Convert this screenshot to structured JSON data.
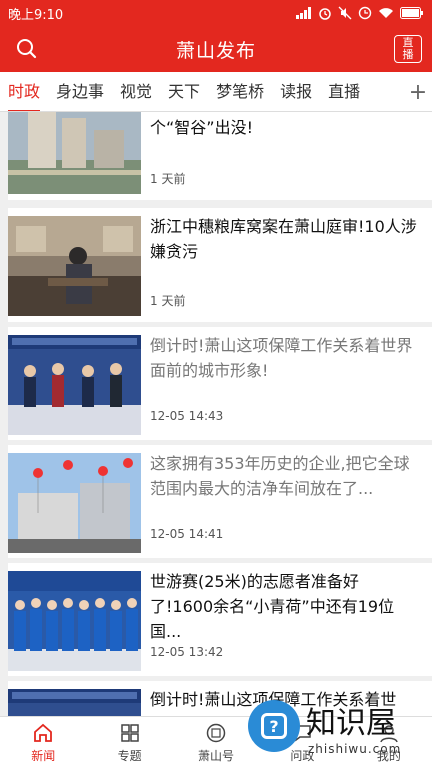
{
  "status": {
    "time": "晚上9:10"
  },
  "header": {
    "title": "萧山发布",
    "live_label": "直播"
  },
  "tabs": [
    "时政",
    "身边事",
    "视觉",
    "天下",
    "梦笔桥",
    "读报",
    "直播"
  ],
  "tab_add": "+",
  "articles": [
    {
      "title": "大动作!数字经济独角兽将在萧山这个“智谷”出没!",
      "time": "1 天前",
      "read": false
    },
    {
      "title": "浙江中穗粮库窝案在萧山庭审!10人涉嫌贪污",
      "time": "1 天前",
      "read": false
    },
    {
      "title": "倒计时!萧山这项保障工作关系着世界面前的城市形象!",
      "time": "12-05 14:43",
      "read": true
    },
    {
      "title": "这家拥有353年历史的企业,把它全球范围内最大的洁净车间放在了...",
      "time": "12-05 14:41",
      "read": true
    },
    {
      "title": "世游赛(25米)的志愿者准备好了!1600余名“小青荷”中还有19位国...",
      "time": "12-05 13:42",
      "read": false
    },
    {
      "title": "倒计时!萧山这项保障工作关系着世",
      "time": "",
      "read": false
    }
  ],
  "bottom_nav": [
    {
      "label": "新闻",
      "icon": "home-icon",
      "active": true
    },
    {
      "label": "专题",
      "icon": "grid-icon",
      "active": false
    },
    {
      "label": "萧山号",
      "icon": "seal-icon",
      "active": false
    },
    {
      "label": "问政",
      "icon": "chat-icon",
      "active": false
    },
    {
      "label": "我的",
      "icon": "user-icon",
      "active": false
    }
  ],
  "watermark": {
    "title": "知识屋",
    "url": "zhishiwu.com"
  },
  "colors": {
    "brand": "#e3281f",
    "read_text": "#777777"
  }
}
